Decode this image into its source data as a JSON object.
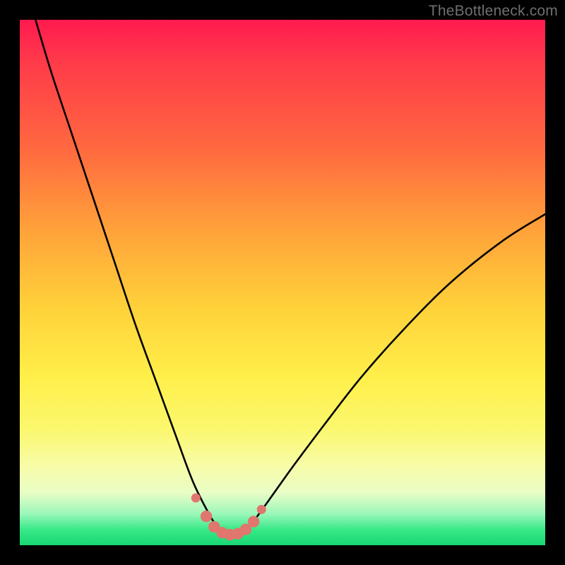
{
  "watermark": "TheBottleneck.com",
  "colors": {
    "background": "#000000",
    "curve": "#000000",
    "marker_fill": "#e0766d",
    "marker_stroke": "#c9574e"
  },
  "chart_data": {
    "type": "line",
    "title": "",
    "xlabel": "",
    "ylabel": "",
    "xlim": [
      0,
      100
    ],
    "ylim": [
      0,
      100
    ],
    "note": "V-shaped bottleneck curve. x roughly = relative performance position; y = bottleneck %. Minimum plateau near y≈2 around x≈36–44.",
    "series": [
      {
        "name": "bottleneck-curve",
        "x": [
          3,
          6,
          10,
          14,
          18,
          22,
          26,
          30,
          33,
          36,
          38,
          40,
          42,
          44,
          47,
          52,
          58,
          65,
          73,
          82,
          92,
          100
        ],
        "y": [
          100,
          90,
          78,
          66,
          54,
          42,
          31,
          20,
          12,
          6,
          3,
          2,
          2.5,
          4,
          8,
          15,
          23,
          32,
          41,
          50,
          58,
          63
        ]
      }
    ],
    "markers": {
      "name": "plateau-markers",
      "x": [
        33.5,
        35.5,
        37,
        38.5,
        40,
        41.5,
        43,
        44.5,
        46
      ],
      "y": [
        9,
        5.5,
        3.5,
        2.4,
        2.0,
        2.2,
        3.0,
        4.5,
        6.8
      ]
    }
  }
}
